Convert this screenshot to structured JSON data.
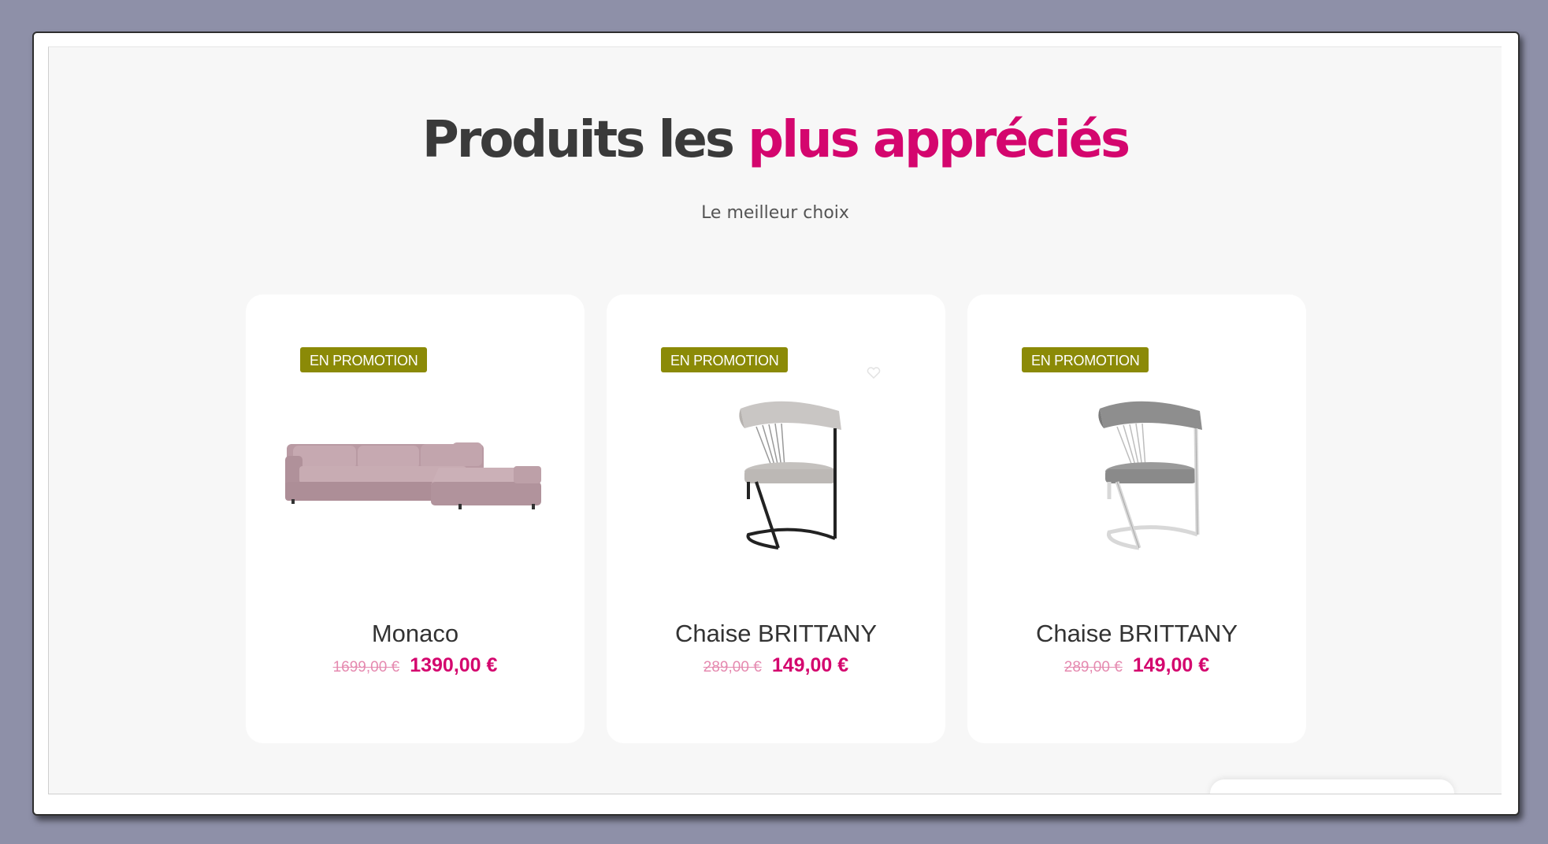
{
  "section": {
    "title_part1": "Produits les",
    "title_part2": "plus appréciés",
    "subtitle": "Le meilleur choix"
  },
  "colors": {
    "accent": "#d4066e",
    "badge": "#8b8a07",
    "title_dark": "#3a3a3a"
  },
  "products": [
    {
      "badge": "EN PROMOTION",
      "name": "Monaco",
      "old_price": "1699,00 €",
      "new_price": "1390,00 €",
      "image_icon": "sofa-image"
    },
    {
      "badge": "EN PROMOTION",
      "name": "Chaise BRITTANY",
      "old_price": "289,00 €",
      "new_price": "149,00 €",
      "image_icon": "chair-black-frame-image"
    },
    {
      "badge": "EN PROMOTION",
      "name": "Chaise BRITTANY",
      "old_price": "289,00 €",
      "new_price": "149,00 €",
      "image_icon": "chair-chrome-frame-image"
    }
  ]
}
